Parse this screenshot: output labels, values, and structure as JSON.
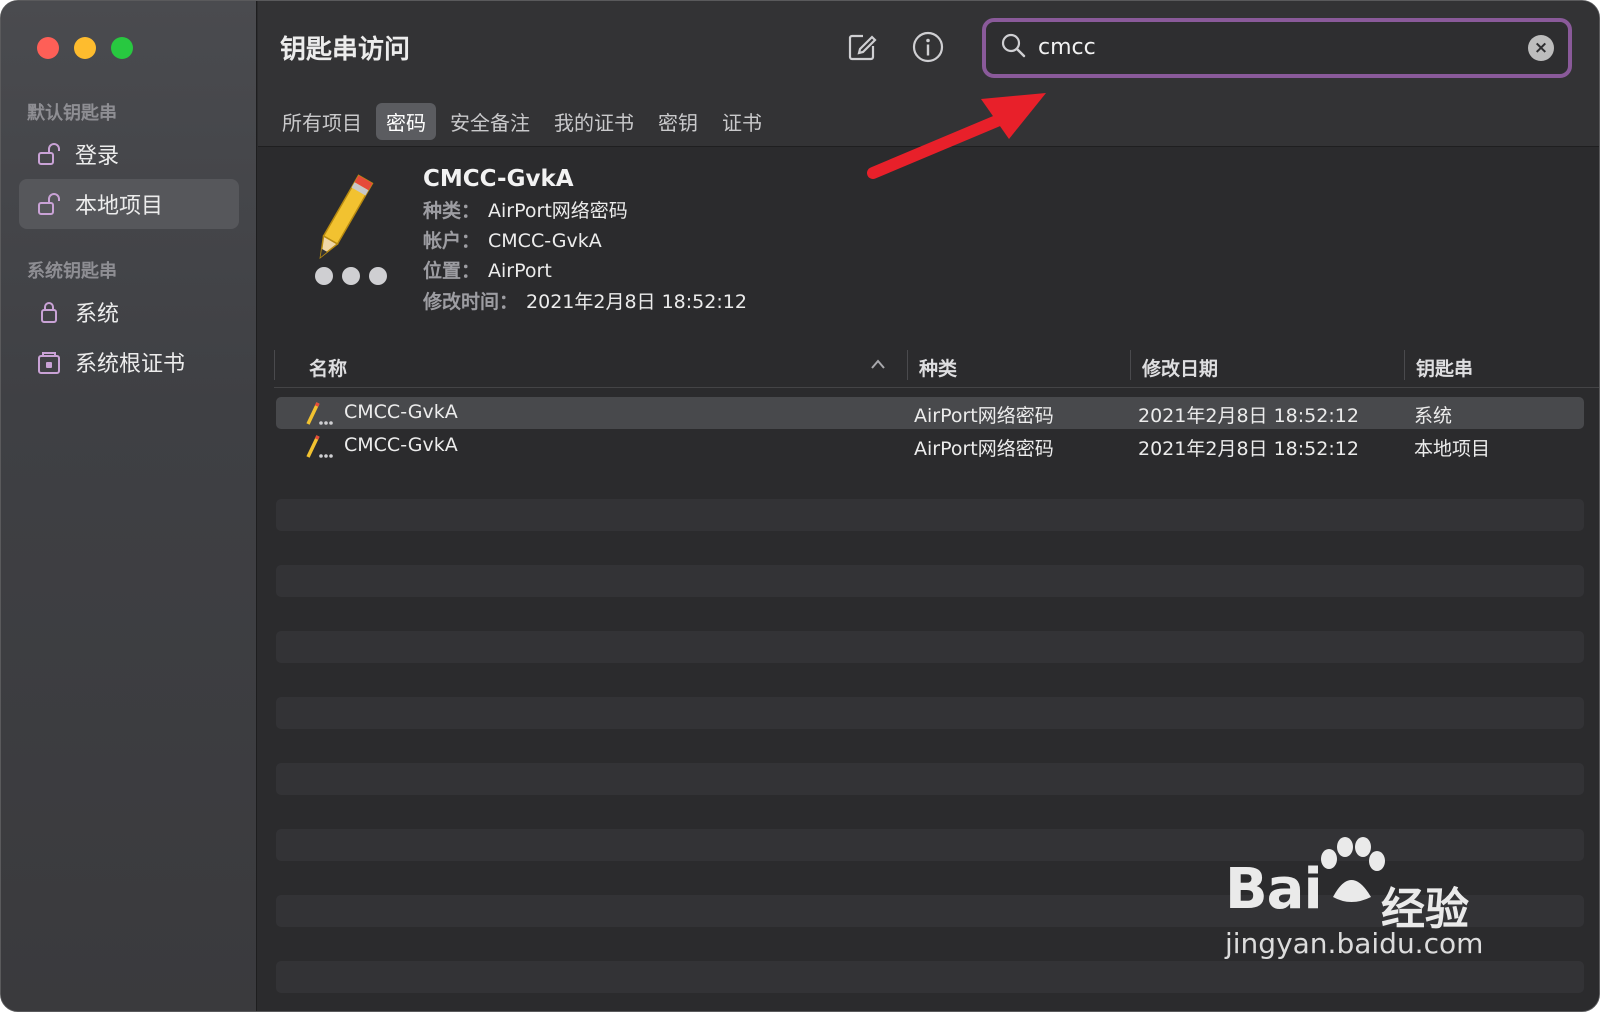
{
  "window": {
    "title": "钥匙串访问",
    "traffic_lights": {
      "close": "#fe5f57",
      "minimize": "#febc2e",
      "zoom": "#28c840"
    }
  },
  "sidebar": {
    "sections": [
      {
        "label": "默认钥匙串",
        "items": [
          {
            "label": "登录",
            "icon": "unlocked-padlock-icon",
            "selected": false
          },
          {
            "label": "本地项目",
            "icon": "unlocked-padlock-icon",
            "selected": true
          }
        ]
      },
      {
        "label": "系统钥匙串",
        "items": [
          {
            "label": "系统",
            "icon": "locked-padlock-icon",
            "selected": false
          },
          {
            "label": "系统根证书",
            "icon": "locked-cabinet-icon",
            "selected": false
          }
        ]
      }
    ]
  },
  "toolbar": {
    "new_item_icon": "compose-icon",
    "info_icon": "info-icon",
    "search": {
      "value": "cmcc",
      "icon": "search-icon",
      "clear_icon": "clear-icon",
      "highlight_color": "#8a5a9a"
    }
  },
  "tabs": [
    {
      "label": "所有项目",
      "active": false
    },
    {
      "label": "密码",
      "active": true
    },
    {
      "label": "安全备注",
      "active": false
    },
    {
      "label": "我的证书",
      "active": false
    },
    {
      "label": "密钥",
      "active": false
    },
    {
      "label": "证书",
      "active": false
    }
  ],
  "detail": {
    "icon": "pencil-password-icon",
    "name": "CMCC-GvkA",
    "kind_key": "种类：",
    "kind_value": "AirPort网络密码",
    "account_key": "帐户：",
    "account_value": "CMCC-GvkA",
    "location_key": "位置：",
    "location_value": "AirPort",
    "modified_key": "修改时间：",
    "modified_value": "2021年2月8日 18:52:12"
  },
  "table": {
    "columns": [
      "名称",
      "种类",
      "修改日期",
      "钥匙串"
    ],
    "sort_icon": "sort-ascending-icon",
    "rows": [
      {
        "name": "CMCC-GvkA",
        "kind": "AirPort网络密码",
        "date": "2021年2月8日 18:52:12",
        "keychain": "系统",
        "selected": true
      },
      {
        "name": "CMCC-GvkA",
        "kind": "AirPort网络密码",
        "date": "2021年2月8日 18:52:12",
        "keychain": "本地项目",
        "selected": false
      }
    ]
  },
  "annotation": {
    "arrow_color": "#e8202a"
  },
  "watermark": {
    "brand_latin": "Bai",
    "brand_cn": "经验",
    "url": "jingyan.baidu.com"
  }
}
